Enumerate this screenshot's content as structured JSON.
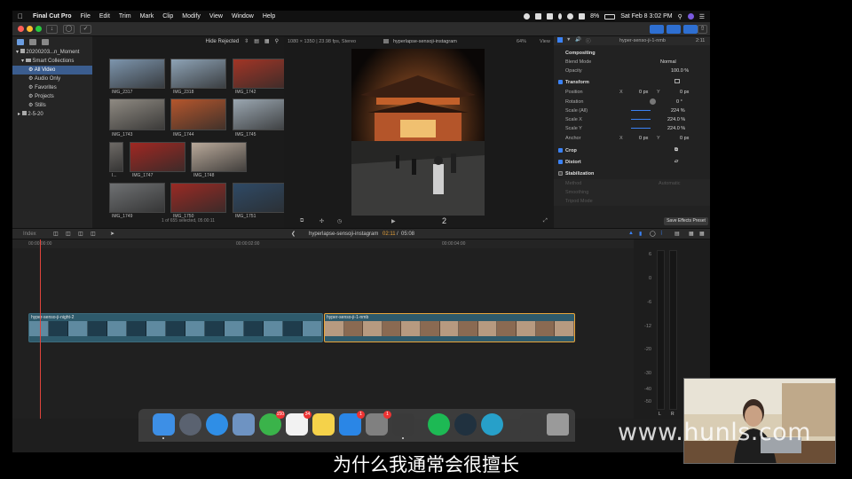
{
  "menubar": {
    "items": [
      "Final Cut Pro",
      "File",
      "Edit",
      "Trim",
      "Mark",
      "Clip",
      "Modify",
      "View",
      "Window",
      "Help"
    ],
    "battery": "8%",
    "datetime": "Sat Feb 8  3:02 PM"
  },
  "sidebar": {
    "items": [
      {
        "label": "20200203...n_Moment",
        "level": 0,
        "selected": false
      },
      {
        "label": "Smart Collections",
        "level": 1,
        "selected": false
      },
      {
        "label": "All Video",
        "level": 2,
        "selected": true
      },
      {
        "label": "Audio Only",
        "level": 2,
        "selected": false
      },
      {
        "label": "Favorites",
        "level": 2,
        "selected": false
      },
      {
        "label": "Projects",
        "level": 2,
        "selected": false
      },
      {
        "label": "Stills",
        "level": 2,
        "selected": false
      },
      {
        "label": "2-5-20",
        "level": 1,
        "selected": false
      }
    ]
  },
  "browser": {
    "filter": "Hide Rejected",
    "status": "1 of 655 selected, 05:00:11",
    "clips": [
      {
        "label": "IMG_2317",
        "color": "#7d95ad"
      },
      {
        "label": "IMG_2318",
        "color": "#8ea3b6"
      },
      {
        "label": "IMG_1742",
        "color": "#a23526"
      },
      {
        "label": "IMG_1743",
        "color": "#8f8a82"
      },
      {
        "label": "IMG_1744",
        "color": "#b5562c"
      },
      {
        "label": "IMG_1745",
        "color": "#9ba7b1"
      },
      {
        "label": "I...",
        "color": "#6e6a66"
      },
      {
        "label": "IMG_1747",
        "color": "#a02822"
      },
      {
        "label": "IMG_1748",
        "color": "#b9a99a"
      },
      {
        "label": "IMG_1749",
        "color": "#6f7173"
      },
      {
        "label": "IMG_1750",
        "color": "#9a2a24"
      },
      {
        "label": "IMG_1751",
        "color": "#2f4a66"
      }
    ]
  },
  "viewer": {
    "format": "1080 × 1350 | 23.98 fps, Stereo",
    "clip_name": "hyperlapse-sensoji-instagram",
    "zoom": "64%",
    "view_label": "View",
    "timecode": "2"
  },
  "inspector": {
    "clip_name": "hyper-senso-ji-1-nmb",
    "duration": "2:11",
    "compositing": "Compositing",
    "blend_mode_label": "Blend Mode",
    "blend_mode_value": "Normal",
    "opacity_label": "Opacity",
    "opacity_value": "100.0 %",
    "transform": "Transform",
    "position_label": "Position",
    "position_x": "0 px",
    "position_y": "0 px",
    "rotation_label": "Rotation",
    "rotation_value": "0 °",
    "scale_all_label": "Scale (All)",
    "scale_all_value": "224 %",
    "scale_x_label": "Scale X",
    "scale_x_value": "224.0 %",
    "scale_y_label": "Scale Y",
    "scale_y_value": "224.0 %",
    "anchor_label": "Anchor",
    "anchor_x": "0 px",
    "anchor_y": "0 px",
    "crop": "Crop",
    "distort": "Distort",
    "stabilization": "Stabilization",
    "method_label": "Method",
    "method_value": "Automatic",
    "smoothing_label": "Smoothing",
    "tripod_label": "Tripod Mode",
    "save_preset": "Save Effects Preset"
  },
  "timeline": {
    "index_label": "Index",
    "project_name": "hyperlapse-sensoji-instagram",
    "position": "02:11",
    "duration": "05:08",
    "ruler": [
      "00:00:00:00",
      "00:00:02:00",
      "00:00:04:00"
    ],
    "clips": [
      {
        "name": "hyper-senso-ji-night-2",
        "color": "#2e5a6b"
      },
      {
        "name": "hyper-senso-ji-1-nmb",
        "color": "#2e5a6b"
      }
    ]
  },
  "meters": {
    "scale": [
      "6",
      "0",
      "-6",
      "-12",
      "-20",
      "-30",
      "-40",
      "-50"
    ],
    "channels": [
      "L",
      "R"
    ]
  },
  "dock": {
    "apps": [
      {
        "name": "finder-icon",
        "color": "#3d8fe6",
        "badge": ""
      },
      {
        "name": "launchpad-icon",
        "color": "#5a6270",
        "badge": ""
      },
      {
        "name": "safari-icon",
        "color": "#2f8ee6",
        "badge": ""
      },
      {
        "name": "preview-icon",
        "color": "#6e93c2",
        "badge": ""
      },
      {
        "name": "messages-icon",
        "color": "#3ab34a",
        "badge": "150"
      },
      {
        "name": "calendar-icon",
        "color": "#f2f2f2",
        "badge": "34"
      },
      {
        "name": "notes-icon",
        "color": "#f5d24a",
        "badge": ""
      },
      {
        "name": "app-store-icon",
        "color": "#2a86e6",
        "badge": "1"
      },
      {
        "name": "system-preferences-icon",
        "color": "#808080",
        "badge": "1"
      },
      {
        "name": "final-cut-pro-icon",
        "color": "#3a3a3a",
        "badge": ""
      },
      {
        "name": "spotify-icon",
        "color": "#1db954",
        "badge": ""
      },
      {
        "name": "quicktime-icon",
        "color": "#20313f",
        "badge": ""
      },
      {
        "name": "teal-app-icon",
        "color": "#27a0c9",
        "badge": ""
      },
      {
        "name": "monitor-app-icon",
        "color": "#3b3b3b",
        "badge": ""
      },
      {
        "name": "trash-icon",
        "color": "#9a9a9a",
        "badge": ""
      }
    ]
  },
  "overlay": {
    "watermark": "www.hunls.com",
    "subtitle": "为什么我通常会很擅长"
  }
}
